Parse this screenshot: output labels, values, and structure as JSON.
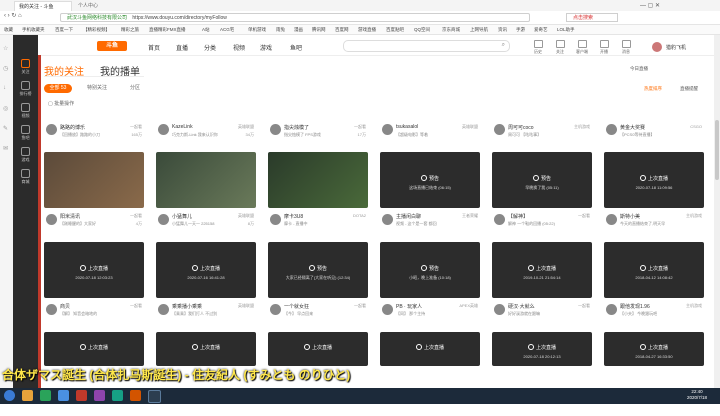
{
  "browser": {
    "tabs": [
      {
        "label": "我的关注 - 斗鱼"
      },
      {
        "label": "个人中心"
      }
    ],
    "url": "https://www.douyu.com/directory/myFollow",
    "url_prefix": "武汉斗鱼网络科技有限公司",
    "search_placeholder": "点击搜索",
    "bookmarks": [
      "收藏",
      "手机收藏夹",
      "百度一下",
      "【精彩视频】",
      "精彩之旅",
      "直播精彩FMX直播",
      "A站",
      "ACG宅",
      "单机游戏",
      "雨兔",
      "漫画",
      "腾讯网",
      "百度网",
      "游戏直播",
      "百度贴吧",
      "QQ空间",
      "京东商城",
      "上网导航",
      "资讯",
      "手游",
      "爱奇艺",
      "LOL助手"
    ]
  },
  "site": {
    "logo": "斗鱼",
    "nav": [
      "首页",
      "直播",
      "分类",
      "视频",
      "游戏",
      "鱼吧"
    ],
    "header_icons": [
      "历史",
      "关注",
      "客户端",
      "开播",
      "消息"
    ],
    "username": "猎豹飞机",
    "side": [
      "关注",
      "排行榜",
      "视频",
      "鱼吧",
      "游戏",
      "商城"
    ]
  },
  "page": {
    "tab_following": "我的关注",
    "tab_anchors": "我的播单",
    "filters": [
      {
        "label": "全部 53"
      },
      {
        "label": "特别关注"
      },
      {
        "label": "分区"
      }
    ],
    "batch_edit": "批量操作",
    "top_right_1": "今日直播",
    "top_right_2": "直播提醒",
    "top_right_3": "热度排序"
  },
  "rows": [
    [
      {
        "name": "路路的博乐",
        "cat": "一起看",
        "desc": "【回播放】路路的小刀",
        "views": "165万",
        "thumb": "none"
      },
      {
        "name": "KazeLink",
        "cat": "英雄联盟",
        "desc": "巧克力斯-Link 我来认识你",
        "views": "34万",
        "thumb": "none"
      },
      {
        "name": "指尖烛模了",
        "cat": "一起看",
        "desc": "指尖烛模了 FPS游戏",
        "views": "17万",
        "thumb": "none"
      },
      {
        "name": "tsukasalol",
        "cat": "英雄联盟",
        "desc": "【超级电影】等着",
        "views": "",
        "thumb": "none"
      },
      {
        "name": "周可可coco",
        "cat": "主机游戏",
        "desc": "周可可 【咕咕事】",
        "views": "",
        "thumb": "none"
      },
      {
        "name": "黄金大奖赛",
        "cat": "CSGO",
        "desc": "【PCS0等待直播】",
        "views": "",
        "thumb": "none"
      }
    ],
    [
      {
        "name": "阳米清讯",
        "cat": "一起看",
        "desc": "【刚睡醒的】大家好",
        "views": "4万",
        "thumb": "live",
        "status": ""
      },
      {
        "name": "小猛舞儿",
        "cat": "英雄联盟",
        "desc": "小猛舞儿一天一 225158",
        "views": "8万",
        "thumb": "game",
        "status": ""
      },
      {
        "name": "摩卡3U8",
        "cat": "DOTA2",
        "desc": "摩卡 - 直播中",
        "views": "",
        "thumb": "video",
        "status": ""
      },
      {
        "name": "主播闲白聊",
        "cat": "王者荣耀",
        "desc": "视频 - 这个是一套 都回",
        "views": "",
        "thumb": "dark",
        "status": "预告",
        "subt": "这场直播已结束 (06:15)"
      },
      {
        "name": "【解神】",
        "cat": "一起看",
        "desc": "解神 一个鞋的回播 (05:22)",
        "views": "",
        "thumb": "dark",
        "status": "预告",
        "subt": "早晚换了我 (05:11)"
      },
      {
        "name": "斯特小美",
        "cat": "主机游戏",
        "desc": "今天的直播结束了,明天早",
        "views": "",
        "thumb": "dark",
        "status": "上次直播",
        "subt": "2020-07-18 11:09:56"
      }
    ],
    [
      {
        "name": "商贝",
        "cat": "一起看",
        "desc": "【解】 知音会暗地的",
        "views": "",
        "thumb": "dark",
        "status": "上次直播",
        "subt": "2020-07-18 12:03:23"
      },
      {
        "name": "乘乘播小乘乘",
        "cat": "英雄联盟",
        "desc": "【乘乘】我们打人 不过别",
        "views": "",
        "thumb": "dark",
        "status": "上次直播",
        "subt": "2020-07-16 16:41:28"
      },
      {
        "name": "一个就女狂",
        "cat": "一起看",
        "desc": "【今】 早点回来",
        "views": "",
        "thumb": "dark",
        "status": "预告",
        "subt": "大家已经隔离了(大家在听见) (12:34)"
      },
      {
        "name": "PB · 玩家人",
        "cat": "APEX英雄",
        "desc": "【同】 那个主持",
        "views": "",
        "thumb": "dark",
        "status": "预告",
        "subt": "小昭，晚上准备 (10:18)"
      },
      {
        "name": "硬汉·大就么",
        "cat": "一起看",
        "desc": "好好溪游就在跟嘛",
        "views": "",
        "thumb": "dark",
        "status": "上次直播",
        "subt": "2019-10-21 21:54:14"
      },
      {
        "name": "跟他发现1.96",
        "cat": "主机游戏",
        "desc": "【小夫】 今晚跟玩吧",
        "views": "",
        "thumb": "dark",
        "status": "上次直播",
        "subt": "2018-04-12 14:08:42"
      }
    ],
    [
      {
        "name": "",
        "cat": "",
        "desc": "",
        "views": "",
        "thumb": "dark",
        "status": "上次直播",
        "subt": ""
      },
      {
        "name": "",
        "cat": "",
        "desc": "",
        "views": "",
        "thumb": "dark",
        "status": "上次直播",
        "subt": ""
      },
      {
        "name": "",
        "cat": "",
        "desc": "",
        "views": "",
        "thumb": "dark",
        "status": "上次直播",
        "subt": ""
      },
      {
        "name": "",
        "cat": "",
        "desc": "",
        "views": "",
        "thumb": "dark",
        "status": "上次直播",
        "subt": ""
      },
      {
        "name": "",
        "cat": "",
        "desc": "",
        "views": "",
        "thumb": "dark",
        "status": "上次直播",
        "subt": "2020-07-18 20:12:13"
      },
      {
        "name": "",
        "cat": "",
        "desc": "",
        "views": "",
        "thumb": "dark",
        "status": "上次直播",
        "subt": "2018-04-27 16:33:50"
      }
    ]
  ],
  "overlay_text": "合体ザマス誕生 (合体扎马斯誕生) - 住友紀人 (すみとも のりひと)",
  "taskbar": {
    "time": "22:40",
    "date": "2020/7/18"
  }
}
